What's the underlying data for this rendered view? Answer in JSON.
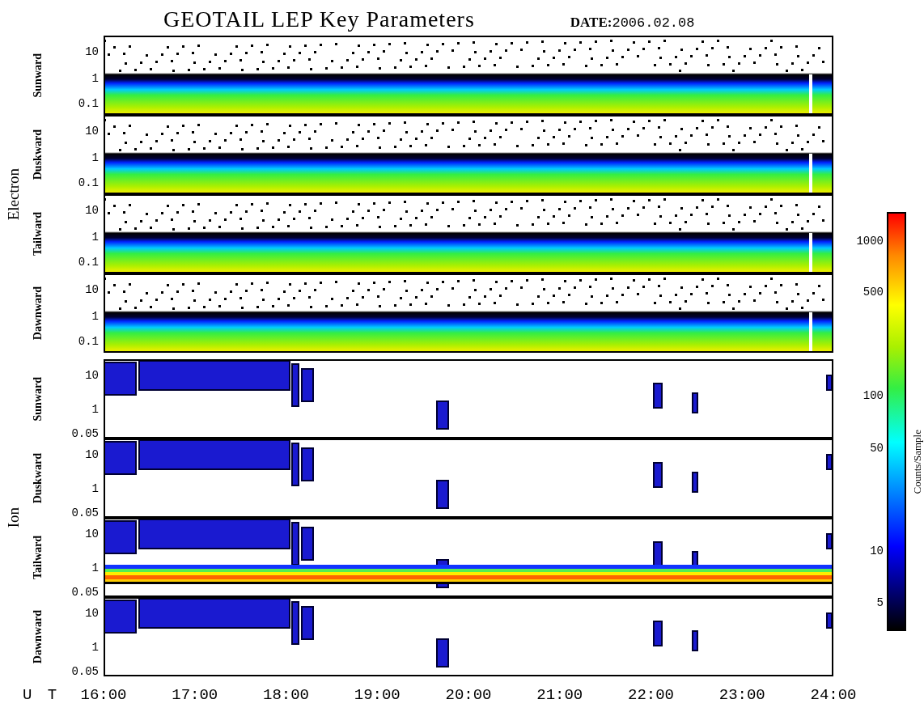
{
  "title": "GEOTAIL LEP Key Parameters",
  "date": {
    "label": "DATE:",
    "value": "2006.02.08"
  },
  "groups": [
    {
      "name": "Electron",
      "kind": "electron",
      "panels": [
        {
          "direction": "Sunward",
          "kind": "electron",
          "yticks": [
            "10",
            "1",
            "0.1"
          ]
        },
        {
          "direction": "Duskward",
          "kind": "electron",
          "yticks": [
            "10",
            "1",
            "0.1"
          ]
        },
        {
          "direction": "Tailward",
          "kind": "electron",
          "yticks": [
            "10",
            "1",
            "0.1"
          ]
        },
        {
          "direction": "Dawnward",
          "kind": "electron",
          "yticks": [
            "10",
            "1",
            "0.1"
          ]
        }
      ]
    },
    {
      "name": "Ion",
      "kind": "ion",
      "panels": [
        {
          "direction": "Sunward",
          "kind": "ion",
          "yticks": [
            "10",
            "1",
            "0.05"
          ]
        },
        {
          "direction": "Duskward",
          "kind": "ion",
          "yticks": [
            "10",
            "1",
            "0.05"
          ]
        },
        {
          "direction": "Tailward",
          "kind": "ion-band",
          "yticks": [
            "10",
            "1",
            "0.05"
          ]
        },
        {
          "direction": "Dawnward",
          "kind": "ion",
          "yticks": [
            "10",
            "1",
            "0.05"
          ]
        }
      ]
    }
  ],
  "x_axis": {
    "label": "U T",
    "ticks": [
      "16:00",
      "17:00",
      "18:00",
      "19:00",
      "20:00",
      "21:00",
      "22:00",
      "23:00",
      "24:00"
    ]
  },
  "colorbar": {
    "title": "Counts/Sample",
    "ticks": [
      "1000",
      "500",
      "100",
      "50",
      "10",
      "5"
    ]
  }
}
